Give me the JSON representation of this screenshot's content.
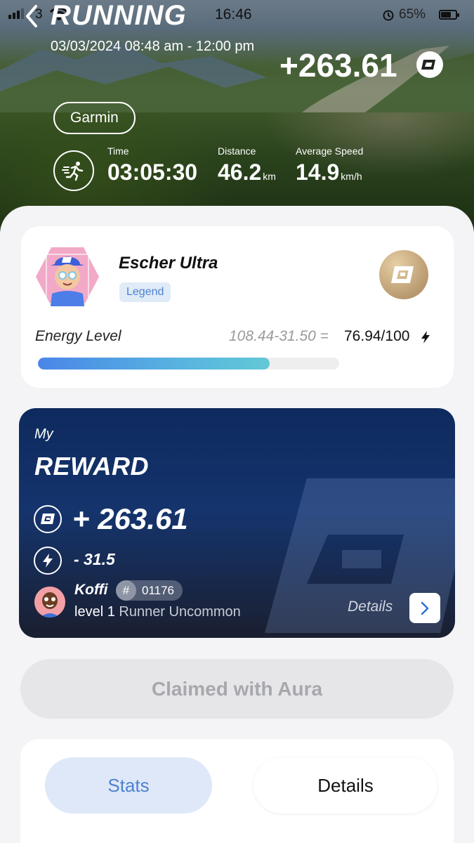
{
  "status_bar": {
    "carrier": "3",
    "time": "16:46",
    "battery": "65%"
  },
  "header": {
    "title": "RUNNING",
    "date_range": "03/03/2024 08:48 am - 12:00 pm",
    "reward_total": "+263.61",
    "source": "Garmin"
  },
  "stats": [
    {
      "label": "Time",
      "value": "03:05:30",
      "unit": ""
    },
    {
      "label": "Distance",
      "value": "46.2",
      "unit": "km"
    },
    {
      "label": "Average Speed",
      "value": "14.9",
      "unit": "km/h"
    }
  ],
  "user": {
    "name": "Escher Ultra",
    "rank": "Legend",
    "energy_label": "Energy Level",
    "energy_formula": "108.44-31.50 =",
    "energy_value": "76.94/100",
    "energy_fraction": 0.7694
  },
  "reward_card": {
    "my": "My",
    "title": "REWARD",
    "amount": "+ 263.61",
    "energy_cost": "- 31.5",
    "runner": {
      "name": "Koffi",
      "id_hash": "#",
      "id": "01176",
      "level": "level 1",
      "class": "Runner Uncommon"
    },
    "details_label": "Details"
  },
  "claimed_button": "Claimed with Aura",
  "tabs": [
    {
      "label": "Stats",
      "active": true
    },
    {
      "label": "Details",
      "active": false
    }
  ],
  "colors": {
    "accent_blue": "#4d82cf",
    "reward_card_bg": "#0e2a5e",
    "energy_gradient_start": "#4a86e8",
    "energy_gradient_end": "#63c8d6"
  },
  "icons": {
    "back": "chevron-left-icon",
    "coin": "coin-icon",
    "runner": "running-man-icon",
    "energy": "lightning-icon",
    "details": "chevron-right-icon"
  }
}
